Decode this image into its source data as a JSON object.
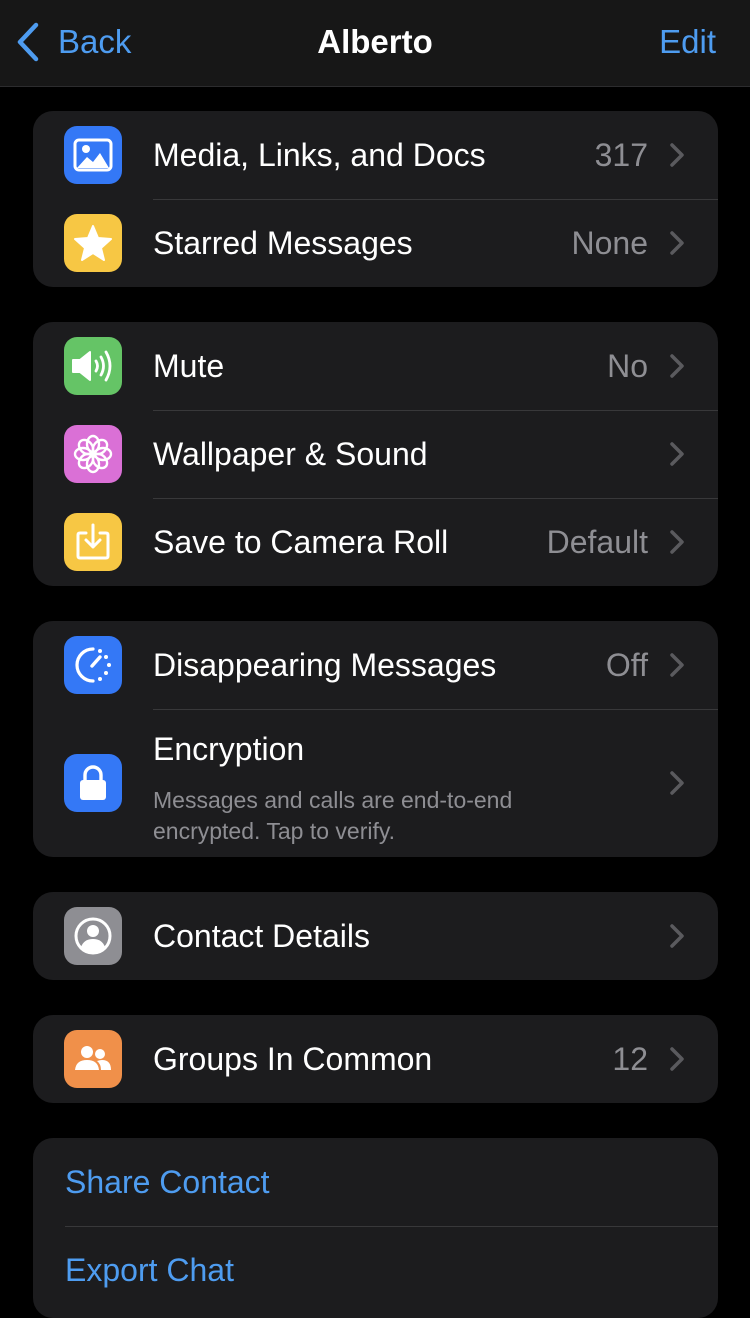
{
  "navbar": {
    "back_label": "Back",
    "title": "Alberto",
    "edit_label": "Edit"
  },
  "colors": {
    "accent": "#4e9cf0",
    "background": "#000000",
    "cell": "#1c1c1e",
    "secondary_text": "#8e8e93"
  },
  "groups": [
    {
      "rows": [
        {
          "icon": "photo-icon",
          "icon_color": "#3478f6",
          "label": "Media, Links, and Docs",
          "value": "317"
        },
        {
          "icon": "star-icon",
          "icon_color": "#f7c744",
          "label": "Starred Messages",
          "value": "None"
        }
      ]
    },
    {
      "rows": [
        {
          "icon": "speaker-icon",
          "icon_color": "#65c466",
          "label": "Mute",
          "value": "No"
        },
        {
          "icon": "flower-icon",
          "icon_color": "#da70d6",
          "label": "Wallpaper & Sound",
          "value": ""
        },
        {
          "icon": "save-download-icon",
          "icon_color": "#f7c744",
          "label": "Save to Camera Roll",
          "value": "Default"
        }
      ]
    },
    {
      "rows": [
        {
          "icon": "timer-icon",
          "icon_color": "#3478f6",
          "label": "Disappearing Messages",
          "value": "Off"
        },
        {
          "icon": "lock-icon",
          "icon_color": "#3478f6",
          "label": "Encryption",
          "subtitle": "Messages and calls are end-to-end encrypted. Tap to verify."
        }
      ]
    },
    {
      "rows": [
        {
          "icon": "contact-icon",
          "icon_color": "#8e8e93",
          "label": "Contact Details",
          "value": ""
        }
      ]
    },
    {
      "rows": [
        {
          "icon": "group-icon",
          "icon_color": "#f0904a",
          "label": "Groups In Common",
          "value": "12"
        }
      ]
    },
    {
      "actions": [
        {
          "label": "Share Contact"
        },
        {
          "label": "Export Chat"
        }
      ]
    }
  ]
}
